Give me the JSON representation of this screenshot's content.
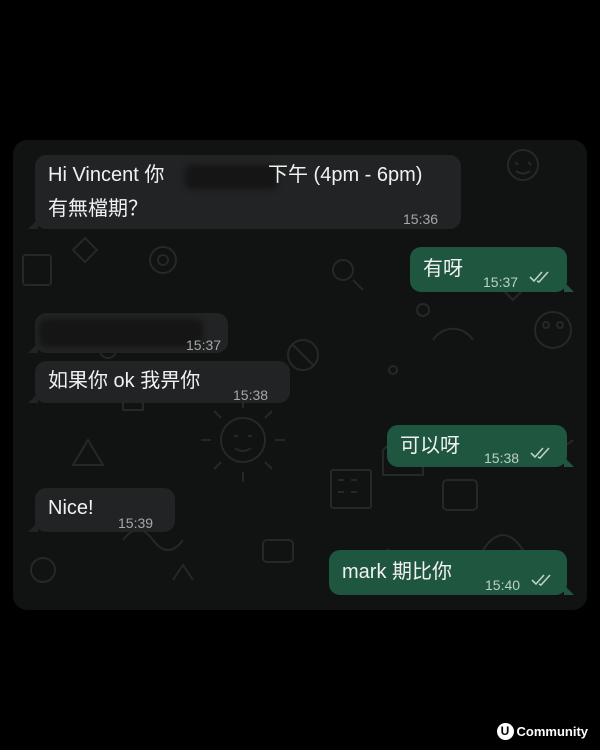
{
  "messages": [
    {
      "direction": "incoming",
      "line1_start": "Hi Vincent 你",
      "line1_end": "下午 (4pm - 6pm)",
      "line2": "有無檔期？",
      "time": "15:36"
    },
    {
      "direction": "outgoing",
      "text": "有呀",
      "time": "15:37",
      "status": "read-double-check"
    },
    {
      "direction": "incoming",
      "text": "",
      "time": "15:37",
      "redacted": true
    },
    {
      "direction": "incoming",
      "text": "如果你 ok 我畀你",
      "time": "15:38"
    },
    {
      "direction": "outgoing",
      "text": "可以呀",
      "time": "15:38",
      "status": "read-double-check"
    },
    {
      "direction": "incoming",
      "text": "Nice!",
      "time": "15:39"
    },
    {
      "direction": "outgoing",
      "text": "mark 期比你",
      "time": "15:40",
      "status": "read-double-check"
    }
  ],
  "theme": {
    "background": "#000000",
    "chat_bg": "#111212",
    "incoming_bubble": "#212324",
    "outgoing_bubble": "#1f5640"
  },
  "watermark": {
    "badge": "U",
    "text": "Community",
    "icon": "u-community-logo-icon"
  }
}
